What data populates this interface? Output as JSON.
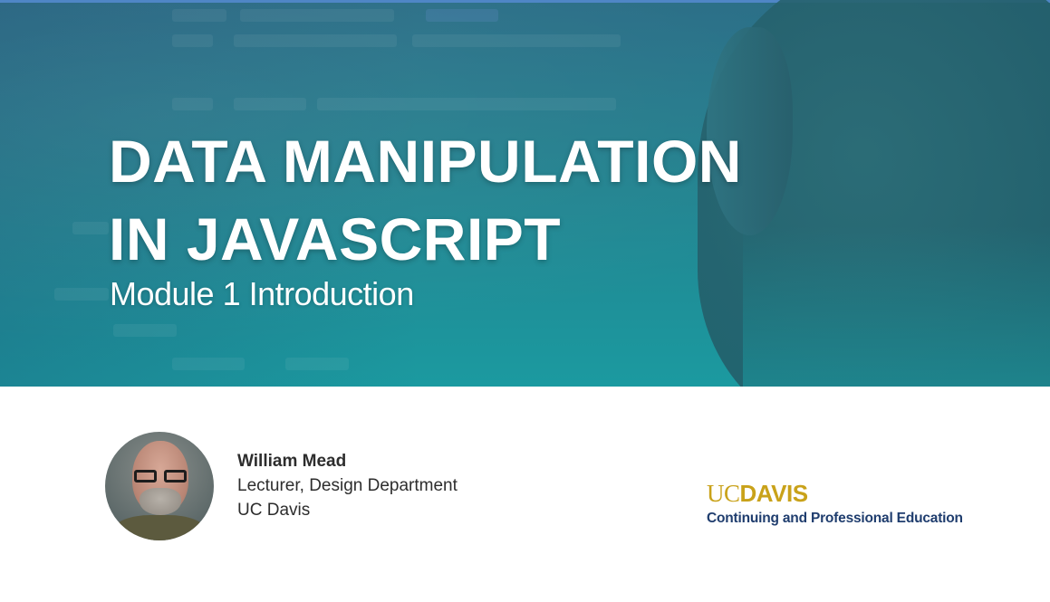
{
  "slide": {
    "title_line1": "DATA MANIPULATION",
    "title_line2": "IN JAVASCRIPT",
    "subtitle": "Module 1 Introduction"
  },
  "presenter": {
    "name": "William Mead",
    "role": "Lecturer, Design Department",
    "affiliation": "UC Davis"
  },
  "logo": {
    "uc": "UC",
    "davis": "DAVIS",
    "tagline": "Continuing and Professional Education"
  },
  "colors": {
    "banner_teal": "#1b9aa0",
    "logo_gold": "#c9a21a",
    "logo_navy": "#1f3d6e"
  }
}
